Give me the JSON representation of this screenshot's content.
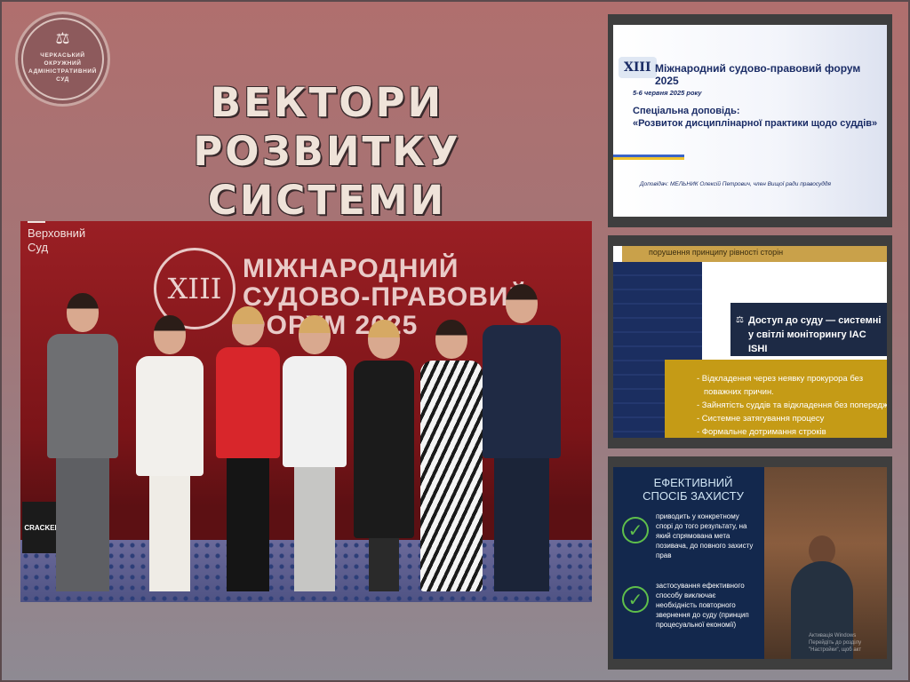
{
  "logo": {
    "lines": [
      "ЧЕРКАСЬКИЙ",
      "ОКРУЖНИЙ",
      "АДМІНІСТРАТИВНИЙ",
      "СУД"
    ],
    "emblem": "scales-icon",
    "color": "#8d5a5c"
  },
  "heading": {
    "line1": "ВЕКТОРИ РОЗВИТКУ",
    "line2": "СИСТЕМИ ПРАВОСУДДЯ"
  },
  "photo": {
    "supreme_court_line1": "Верховний",
    "supreme_court_line2": "Суд",
    "banner_roman": "XIII",
    "banner_title_line1": "МІЖНАРОДНИЙ",
    "banner_title_line2": "СУДОВО-ПРАВОВИЙ",
    "banner_title_line3": "ФОРУМ 2025",
    "crackers_label": "CRACKERS",
    "backdrop_color": "#8b1a1f"
  },
  "slide1": {
    "roman": "XIII",
    "forum_title": "Міжнародний судово-правовий форум 2025",
    "date": "5-6 червня 2025 року",
    "special_report": "Спеціальна доповідь:",
    "report_title": "«Розвиток дисциплінарної практики щодо суддів»",
    "speaker": "Доповідач: МЕЛЬНИК Олексій Петрович, член Вищої ради правосуддя"
  },
  "slide2": {
    "top_strip": "порушення принципу рівності сторін",
    "navy_line1": "Доступ до суду — системні",
    "navy_line2": "у світлі моніторингу IAC ISHI",
    "bullets": [
      "- Відкладення через неявку прокурора без",
      "  поважних причин.",
      "- Зайнятість суддів та відкладення без попередж",
      "- Системне затягування процесу",
      "- Формальне дотримання строків"
    ]
  },
  "slide3": {
    "title_line1": "ЕФЕКТИВНИЙ",
    "title_line2": "СПОСІБ ЗАХИСТУ",
    "point1": "приводить у конкретному спорі до того результату, на який спрямована мета позивача, до повного захисту прав",
    "point2": "застосування ефективного способу виключає необхідність повторного звернення до суду (принцип процесуальної економії)",
    "watermark1": "Активація Windows",
    "watermark2": "Перейдіть до розділу \"Настройки\", щоб акт"
  }
}
